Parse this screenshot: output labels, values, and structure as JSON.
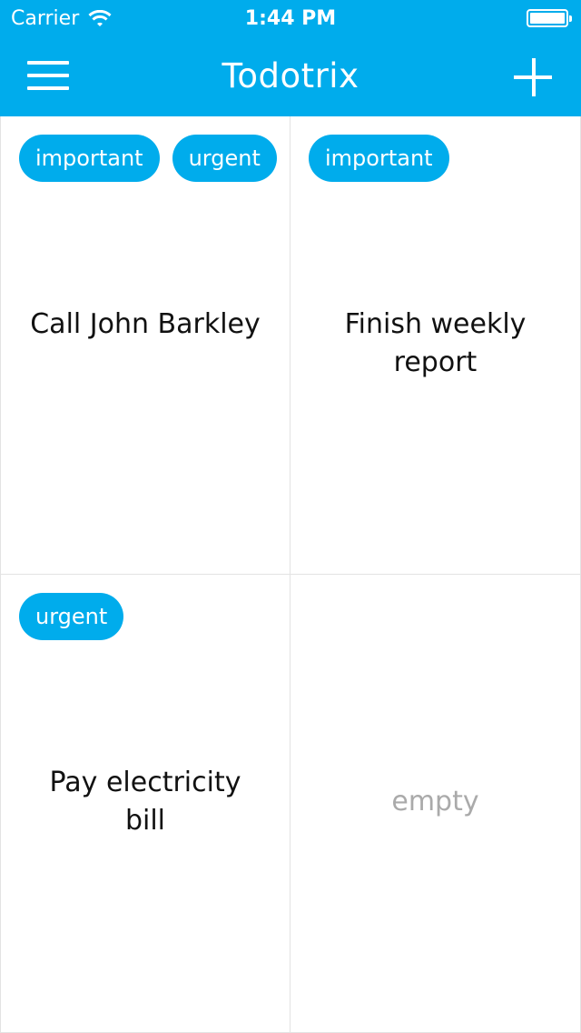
{
  "status_bar": {
    "carrier": "Carrier",
    "time": "1:44 PM",
    "wifi_icon": "wifi-icon",
    "battery_icon": "battery-icon"
  },
  "nav": {
    "title": "Todotrix",
    "menu_icon": "hamburger-menu-icon",
    "add_icon": "plus-icon"
  },
  "colors": {
    "accent": "#00acec",
    "text": "#111111",
    "empty_text": "#aaaaaa",
    "divider": "#e3e3e3"
  },
  "quadrants": [
    {
      "tags": [
        "important",
        "urgent"
      ],
      "title": "Call John Barkley"
    },
    {
      "tags": [
        "important"
      ],
      "title": "Finish weekly report"
    },
    {
      "tags": [
        "urgent"
      ],
      "title": "Pay electricity bill"
    },
    {
      "tags": [],
      "title": "",
      "empty_label": "empty"
    }
  ]
}
